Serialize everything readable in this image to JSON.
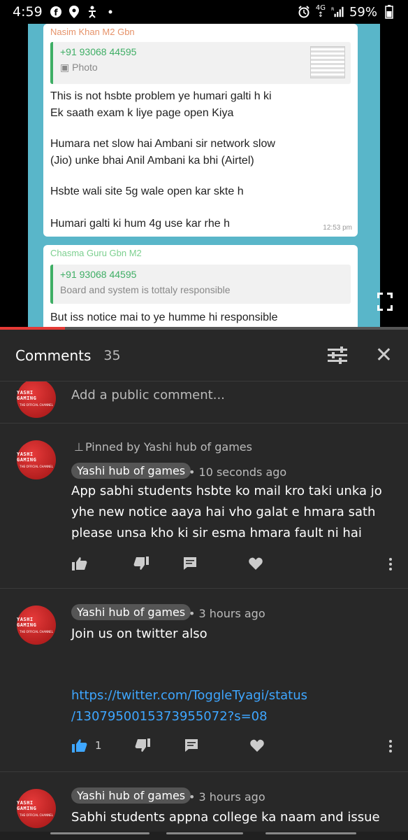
{
  "status_bar": {
    "time": "4:59",
    "network_label": "4G",
    "network_sub": "R",
    "battery": "59%"
  },
  "video": {
    "bubble1": {
      "sender": "Nasim Khan M2 Gbn",
      "quote_number": "+91 93068 44595",
      "quote_sub": "Photo",
      "lines": [
        "This is not hsbte problem ye humari galti h ki",
        "Ek saath exam k liye page open Kiya",
        "Humara net slow hai Ambani sir network slow",
        "(Jio) unke bhai Anil Ambani ka bhi (Airtel)",
        "Hsbte wali site 5g wale open kar skte h",
        "Humari galti ki hum 4g use kar rhe h"
      ],
      "time": "12:53 pm"
    },
    "bubble2": {
      "sender": "Chasma Guru Gbn M2",
      "quote_number": "+91 93068 44595",
      "quote_sub": "Board and system is tottaly responsible",
      "line": "But iss notice mai to ye humme hi responsible"
    },
    "progress": 0.16
  },
  "comments_header": {
    "title": "Comments",
    "count": "35"
  },
  "add_comment": {
    "placeholder": "Add a public comment..."
  },
  "avatar": {
    "line1": "YASHI GAMING",
    "line2": "THE OFFICIAL CHANNEL"
  },
  "comments": [
    {
      "pinned": "Pinned by Yashi hub of games",
      "author": "Yashi hub of games",
      "ago": "• 10 seconds ago",
      "lines": [
        "App sabhi students hsbte ko mail kro taki unka jo",
        "yhe new notice aaya hai vho galat e hmara sath",
        "please unsa kho ki sir esma hmara fault ni hai"
      ],
      "likes": ""
    },
    {
      "author": "Yashi hub of games",
      "ago": "• 3 hours ago",
      "line": "Join us on twitter also",
      "link_line1": "https://twitter.com/ToggleTyagi/status",
      "link_line2": "/1307950015373955072?s=08",
      "likes": "1"
    },
    {
      "author": "Yashi hub of games",
      "ago": "• 3 hours ago",
      "line": "Sabhi students appna college ka naam and issue ya"
    }
  ]
}
